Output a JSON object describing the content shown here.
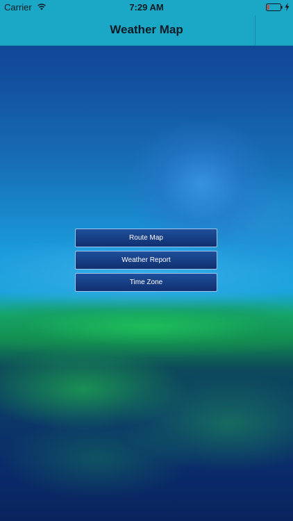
{
  "status_bar": {
    "carrier": "Carrier",
    "time": "7:29 AM",
    "icons": [
      "wifi-icon",
      "battery-icon",
      "charging-icon"
    ]
  },
  "nav": {
    "title": "Weather Map"
  },
  "menu": {
    "items": [
      {
        "label": "Route Map"
      },
      {
        "label": "Weather Report"
      },
      {
        "label": "Time Zone"
      }
    ]
  },
  "colors": {
    "bar_background": "#1ba7c6",
    "button_background": "#173f86",
    "button_border": "#9fc6ee",
    "battery_low": "#e53b35"
  }
}
